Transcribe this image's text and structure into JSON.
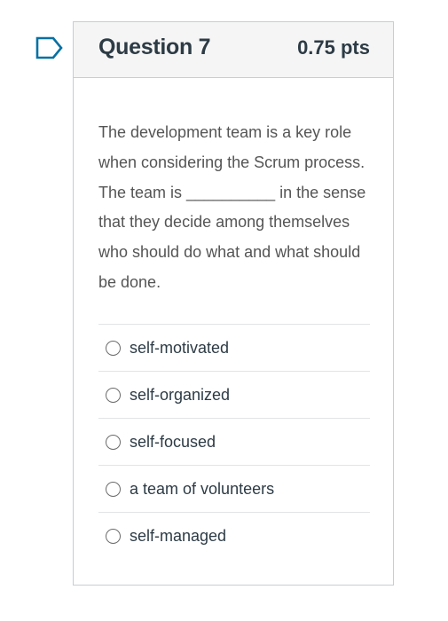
{
  "colors": {
    "accent": "#0770a3",
    "header_bg": "#f5f5f5",
    "border": "#c7cdd1",
    "title_text": "#2d3b45",
    "body_text": "#555555"
  },
  "flag": {
    "icon": "bookmark-flag-icon"
  },
  "question": {
    "title": "Question 7",
    "points": "0.75 pts",
    "text": "The development team is a key role when considering the Scrum process. The team is __________ in the sense that they decide among themselves who should do what and what should be done.",
    "answers": [
      {
        "label": "self-motivated",
        "selected": false
      },
      {
        "label": "self-organized",
        "selected": false
      },
      {
        "label": "self-focused",
        "selected": false
      },
      {
        "label": "a team of volunteers",
        "selected": false
      },
      {
        "label": "self-managed",
        "selected": false
      }
    ]
  }
}
